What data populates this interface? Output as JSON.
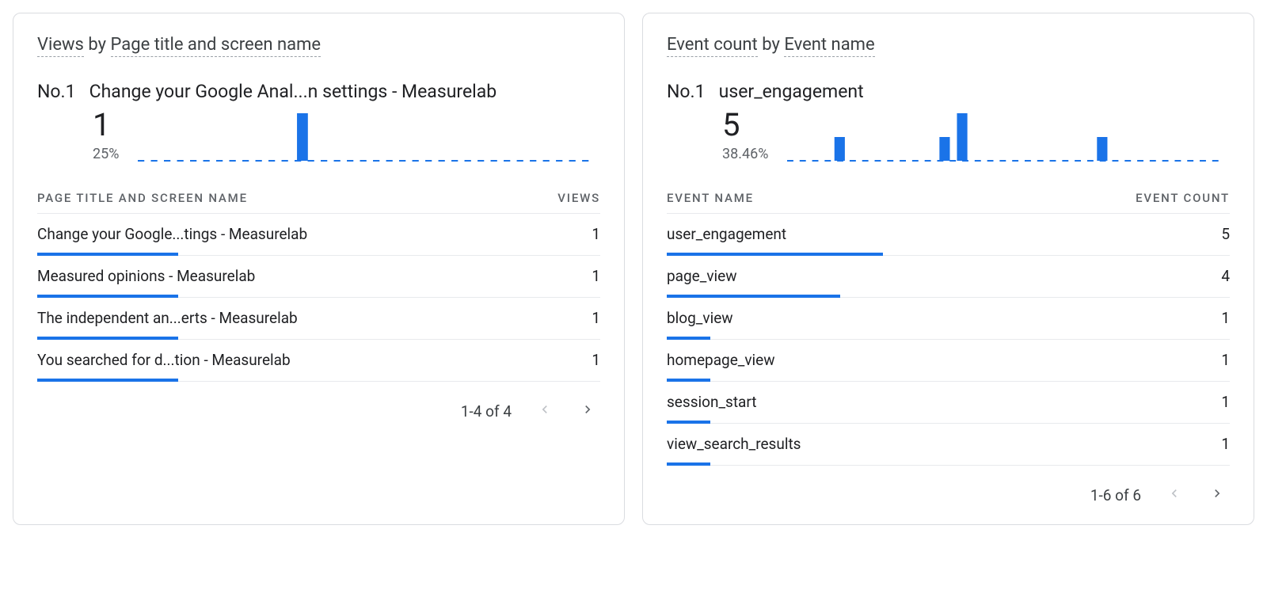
{
  "cards": [
    {
      "title_metric": "Views",
      "title_by": "by",
      "title_dim": "Page title and screen name",
      "hero": {
        "rank": "No.1",
        "name": "Change your Google Anal...n settings - Measurelab",
        "value": "1",
        "pct": "25%"
      },
      "spark": {
        "bars": [
          1
        ],
        "positions": [
          0.36
        ],
        "max": 1
      },
      "columns": {
        "name": "PAGE TITLE AND SCREEN NAME",
        "value": "VIEWS"
      },
      "rows": [
        {
          "name": "Change your Google...tings - Measurelab",
          "value": "1",
          "bar_pct": 25
        },
        {
          "name": "Measured opinions - Measurelab",
          "value": "1",
          "bar_pct": 25
        },
        {
          "name": "The independent an...erts - Measurelab",
          "value": "1",
          "bar_pct": 25
        },
        {
          "name": "You searched for d...tion - Measurelab",
          "value": "1",
          "bar_pct": 25
        }
      ],
      "pager": {
        "label": "1-4 of 4",
        "prev_enabled": false,
        "next_enabled": false
      }
    },
    {
      "title_metric": "Event count",
      "title_by": "by",
      "title_dim": "Event name",
      "hero": {
        "rank": "No.1",
        "name": "user_engagement",
        "value": "5",
        "pct": "38.46%"
      },
      "spark": {
        "bars": [
          1,
          1,
          2,
          1
        ],
        "positions": [
          0.12,
          0.36,
          0.4,
          0.72
        ],
        "max": 2
      },
      "columns": {
        "name": "EVENT NAME",
        "value": "EVENT COUNT"
      },
      "rows": [
        {
          "name": "user_engagement",
          "value": "5",
          "bar_pct": 38.46
        },
        {
          "name": "page_view",
          "value": "4",
          "bar_pct": 30.77
        },
        {
          "name": "blog_view",
          "value": "1",
          "bar_pct": 7.69
        },
        {
          "name": "homepage_view",
          "value": "1",
          "bar_pct": 7.69
        },
        {
          "name": "session_start",
          "value": "1",
          "bar_pct": 7.69
        },
        {
          "name": "view_search_results",
          "value": "1",
          "bar_pct": 7.69
        }
      ],
      "pager": {
        "label": "1-6 of 6",
        "prev_enabled": false,
        "next_enabled": false
      }
    }
  ],
  "colors": {
    "accent": "#1a73e8",
    "spark_axis": "#1a73e8"
  },
  "chart_data": [
    {
      "type": "bar",
      "title": "Views by Page title and screen name — No.1 sparkline",
      "series": [
        {
          "name": "Views",
          "values": [
            1
          ]
        }
      ],
      "categories": [
        "bucket-1"
      ],
      "positions_fraction": [
        0.36
      ],
      "ylim": [
        0,
        1
      ],
      "note": "Sparkline; x has no labeled ticks, positions are fractional along the axis."
    },
    {
      "type": "bar",
      "title": "Event count by Event name — No.1 sparkline",
      "series": [
        {
          "name": "Event count",
          "values": [
            1,
            1,
            2,
            1
          ]
        }
      ],
      "categories": [
        "bucket-1",
        "bucket-2",
        "bucket-3",
        "bucket-4"
      ],
      "positions_fraction": [
        0.12,
        0.36,
        0.4,
        0.72
      ],
      "ylim": [
        0,
        2
      ],
      "note": "Sparkline; x has no labeled ticks, positions are fractional along the axis."
    },
    {
      "type": "table",
      "title": "Views by Page title and screen name",
      "columns": [
        "Page title and screen name",
        "Views"
      ],
      "rows": [
        [
          "Change your Google...tings - Measurelab",
          1
        ],
        [
          "Measured opinions - Measurelab",
          1
        ],
        [
          "The independent an...erts - Measurelab",
          1
        ],
        [
          "You searched for d...tion - Measurelab",
          1
        ]
      ]
    },
    {
      "type": "table",
      "title": "Event count by Event name",
      "columns": [
        "Event name",
        "Event count"
      ],
      "rows": [
        [
          "user_engagement",
          5
        ],
        [
          "page_view",
          4
        ],
        [
          "blog_view",
          1
        ],
        [
          "homepage_view",
          1
        ],
        [
          "session_start",
          1
        ],
        [
          "view_search_results",
          1
        ]
      ]
    }
  ]
}
